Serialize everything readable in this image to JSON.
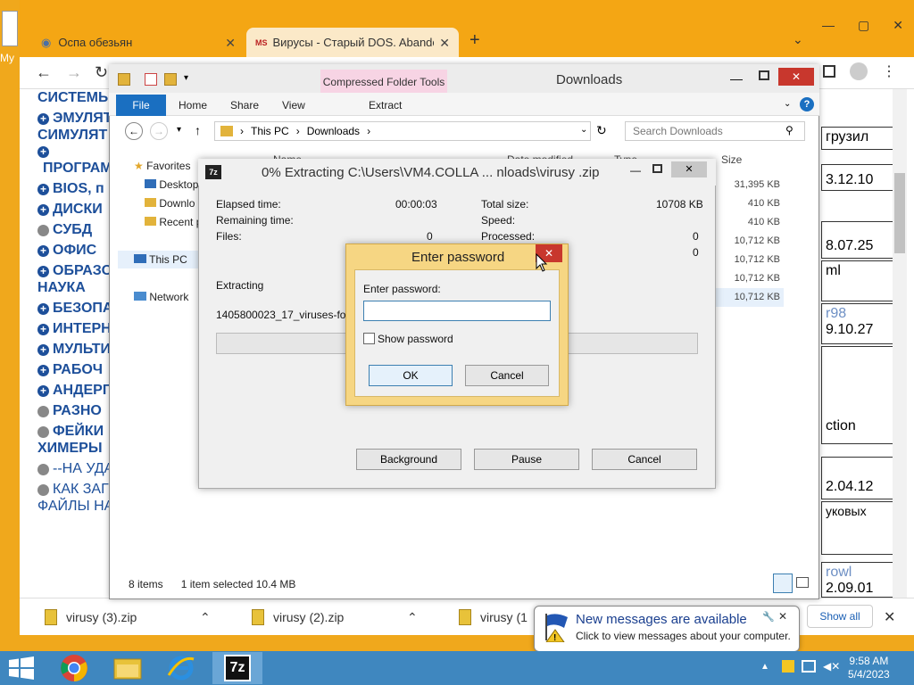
{
  "desktop": {
    "label": "My"
  },
  "chrome": {
    "tabs": [
      {
        "label": "Оспа обезьян"
      },
      {
        "label": "Вирусы - Старый DOS. Abandor"
      }
    ],
    "new_tab": "+",
    "dropdown": "⌄"
  },
  "webpage": {
    "menu": [
      {
        "label": "СИСТЕМЫ",
        "icon": "none"
      },
      {
        "label": "ЭМУЛЯТ",
        "icon": "plus"
      },
      {
        "label": "СИМУЛЯТ",
        "icon": "none"
      },
      {
        "label": "",
        "icon": "plus"
      },
      {
        "label": "ПРОГРАМ",
        "icon": "none"
      },
      {
        "label": "BIOS, п",
        "icon": "plus"
      },
      {
        "label": "ДИСКИ",
        "icon": "plus"
      },
      {
        "label": "СУБД",
        "icon": "dot"
      },
      {
        "label": "ОФИС",
        "icon": "plus"
      },
      {
        "label": "ОБРАЗО",
        "icon": "plus"
      },
      {
        "label": "НАУКА",
        "icon": "none"
      },
      {
        "label": "БЕЗОПА",
        "icon": "plus"
      },
      {
        "label": "ИНТЕРН",
        "icon": "plus"
      },
      {
        "label": "МУЛЬТИ",
        "icon": "plus"
      },
      {
        "label": "РАБОЧ",
        "icon": "plus"
      },
      {
        "label": "АНДЕРГ",
        "icon": "plus"
      },
      {
        "label": "РАЗНО",
        "icon": "dot"
      },
      {
        "label": "ФЕЙКИ",
        "icon": "dot"
      },
      {
        "label": "ХИМЕРЫ",
        "icon": "none"
      },
      {
        "label": "--НА УДА",
        "icon": "dot"
      },
      {
        "label": "КАК ЗАГ",
        "icon": "dot"
      },
      {
        "label": "ФАЙЛЫ НА",
        "icon": "none"
      }
    ],
    "right_cells": [
      "грузил",
      "3.12.10",
      "8.07.25",
      "ml",
      "r98",
      "9.10.27",
      "ction",
      "2.04.12",
      "уковых",
      "rowl",
      "2.09.01"
    ]
  },
  "downloads_bar": {
    "items": [
      {
        "name": "virusy (3).zip"
      },
      {
        "name": "virusy (2).zip"
      },
      {
        "name": "virusy (1"
      }
    ],
    "show_all": "Show all"
  },
  "explorer": {
    "title": "Downloads",
    "compressed_tools": "Compressed Folder Tools",
    "ribbon_tabs": [
      "File",
      "Home",
      "Share",
      "View"
    ],
    "extract_tab": "Extract",
    "breadcrumb": [
      "This PC",
      "Downloads"
    ],
    "search_placeholder": "Search Downloads",
    "columns": {
      "name": "Name",
      "date": "Date modified",
      "type": "Type",
      "size": "Size"
    },
    "nav": {
      "favorites": "Favorites",
      "desktop": "Desktop",
      "downloads": "Downlo",
      "recent": "Recent p",
      "this_pc": "This PC",
      "network": "Network"
    },
    "sizes": [
      "31,395 KB",
      "410 KB",
      "410 KB",
      "10,712 KB",
      "10,712 KB",
      "10,712 KB",
      "10,712 KB"
    ],
    "status": {
      "count": "8 items",
      "selected": "1 item selected 10.4 MB"
    }
  },
  "sevenzip": {
    "title": "0% Extracting C:\\Users\\VM4.COLLA ... nloads\\virusy .zip",
    "icon_text": "7z",
    "elapsed_label": "Elapsed time:",
    "elapsed": "00:00:03",
    "remaining_label": "Remaining time:",
    "files_label": "Files:",
    "files": "0",
    "total_label": "Total size:",
    "total": "10708 KB",
    "speed_label": "Speed:",
    "processed_label": "Processed:",
    "processed": "0",
    "row4_value": "0",
    "extracting_label": "Extracting",
    "file": "1405800023_17_viruses-for-an",
    "progress": 0,
    "buttons": {
      "background": "Background",
      "pause": "Pause",
      "cancel": "Cancel"
    }
  },
  "password_dialog": {
    "title": "Enter password",
    "label": "Enter password:",
    "value": "",
    "show_password": "Show password",
    "ok": "OK",
    "cancel": "Cancel"
  },
  "notification": {
    "title": "New messages are available",
    "text": "Click to view messages about your computer."
  },
  "taskbar": {
    "time": "9:58 AM",
    "date": "5/4/2023",
    "sevenzip_label": "7z"
  },
  "colors": {
    "accent": "#1a6fc1",
    "taskbar": "#3f87bf",
    "desktop": "#f0a81c",
    "link": "#1d4f9a"
  }
}
